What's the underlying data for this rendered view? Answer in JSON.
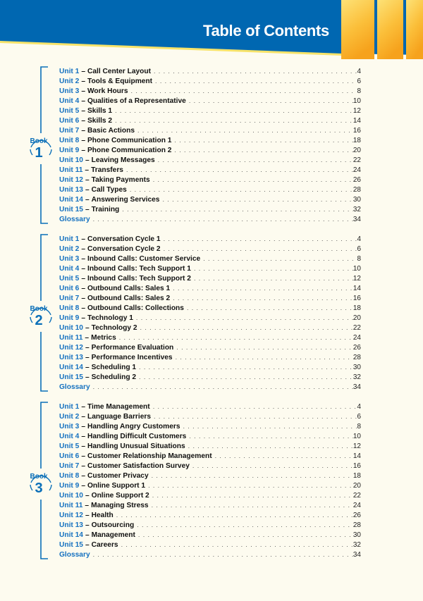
{
  "header": {
    "title": "Table of Contents",
    "colors": {
      "blue": "#0067b1",
      "yellow": "#f7e36a",
      "orange": "#f9a825",
      "background": "#fdfbef",
      "accent_text": "#1571c0"
    }
  },
  "books": [
    {
      "word": "Book",
      "number": "1",
      "entries": [
        {
          "unit": "Unit 1",
          "title": "Call Center Layout",
          "page": "4"
        },
        {
          "unit": "Unit 2",
          "title": "Tools & Equipment",
          "page": "6"
        },
        {
          "unit": "Unit 3",
          "title": "Work Hours",
          "page": "8"
        },
        {
          "unit": "Unit 4",
          "title": "Qualities of a Representative",
          "page": "10"
        },
        {
          "unit": "Unit 5",
          "title": "Skills 1",
          "page": "12"
        },
        {
          "unit": "Unit 6",
          "title": "Skills 2",
          "page": "14"
        },
        {
          "unit": "Unit 7",
          "title": "Basic Actions",
          "page": "16"
        },
        {
          "unit": "Unit 8",
          "title": "Phone Communication 1",
          "page": "18"
        },
        {
          "unit": "Unit 9",
          "title": "Phone Communication 2",
          "page": "20"
        },
        {
          "unit": "Unit 10",
          "title": "Leaving Messages",
          "page": "22"
        },
        {
          "unit": "Unit 11",
          "title": "Transfers",
          "page": "24"
        },
        {
          "unit": "Unit 12",
          "title": "Taking Payments",
          "page": "26"
        },
        {
          "unit": "Unit 13",
          "title": "Call Types",
          "page": "28"
        },
        {
          "unit": "Unit 14",
          "title": "Answering Services",
          "page": "30"
        },
        {
          "unit": "Unit 15",
          "title": "Training",
          "page": "32"
        }
      ],
      "glossary": {
        "label": "Glossary",
        "page": "34"
      }
    },
    {
      "word": "Book",
      "number": "2",
      "entries": [
        {
          "unit": "Unit 1",
          "title": "Conversation Cycle 1",
          "page": "4"
        },
        {
          "unit": "Unit 2",
          "title": "Conversation Cycle 2",
          "page": "6"
        },
        {
          "unit": "Unit 3",
          "title": "Inbound Calls: Customer Service",
          "page": "8"
        },
        {
          "unit": "Unit 4",
          "title": "Inbound Calls: Tech Support 1",
          "page": "10"
        },
        {
          "unit": "Unit 5",
          "title": "Inbound Calls: Tech Support 2",
          "page": "12"
        },
        {
          "unit": "Unit 6",
          "title": "Outbound Calls: Sales 1",
          "page": "14"
        },
        {
          "unit": "Unit 7",
          "title": "Outbound Calls: Sales 2",
          "page": "16"
        },
        {
          "unit": "Unit 8",
          "title": "Outbound Calls: Collections",
          "page": "18"
        },
        {
          "unit": "Unit 9",
          "title": "Technology 1",
          "page": "20"
        },
        {
          "unit": "Unit 10",
          "title": "Technology 2",
          "page": "22"
        },
        {
          "unit": "Unit 11",
          "title": "Metrics",
          "page": "24"
        },
        {
          "unit": "Unit 12",
          "title": "Performance Evaluation",
          "page": "26"
        },
        {
          "unit": "Unit 13",
          "title": "Performance Incentives",
          "page": "28"
        },
        {
          "unit": "Unit 14",
          "title": "Scheduling 1",
          "page": "30"
        },
        {
          "unit": "Unit 15",
          "title": "Scheduling 2",
          "page": "32"
        }
      ],
      "glossary": {
        "label": "Glossary",
        "page": "34"
      }
    },
    {
      "word": "Book",
      "number": "3",
      "entries": [
        {
          "unit": "Unit 1",
          "title": "Time Management",
          "page": "4"
        },
        {
          "unit": "Unit 2",
          "title": "Language Barriers",
          "page": "6"
        },
        {
          "unit": "Unit 3",
          "title": "Handling Angry Customers",
          "page": "8"
        },
        {
          "unit": "Unit 4",
          "title": "Handling Difficult Customers",
          "page": "10"
        },
        {
          "unit": "Unit 5",
          "title": "Handling Unusual Situations",
          "page": "12"
        },
        {
          "unit": "Unit 6",
          "title": "Customer Relationship Management",
          "page": "14"
        },
        {
          "unit": "Unit 7",
          "title": "Customer Satisfaction Survey",
          "page": "16"
        },
        {
          "unit": "Unit 8",
          "title": "Customer Privacy",
          "page": "18"
        },
        {
          "unit": "Unit 9",
          "title": "Online Support 1",
          "page": "20"
        },
        {
          "unit": "Unit 10",
          "title": "Online Support 2",
          "page": "22"
        },
        {
          "unit": "Unit 11",
          "title": "Managing Stress",
          "page": "24"
        },
        {
          "unit": "Unit 12",
          "title": "Health",
          "page": "26"
        },
        {
          "unit": "Unit 13",
          "title": "Outsourcing",
          "page": "28"
        },
        {
          "unit": "Unit 14",
          "title": "Management",
          "page": "30"
        },
        {
          "unit": "Unit 15",
          "title": "Careers",
          "page": "32"
        }
      ],
      "glossary": {
        "label": "Glossary",
        "page": "34"
      }
    }
  ]
}
